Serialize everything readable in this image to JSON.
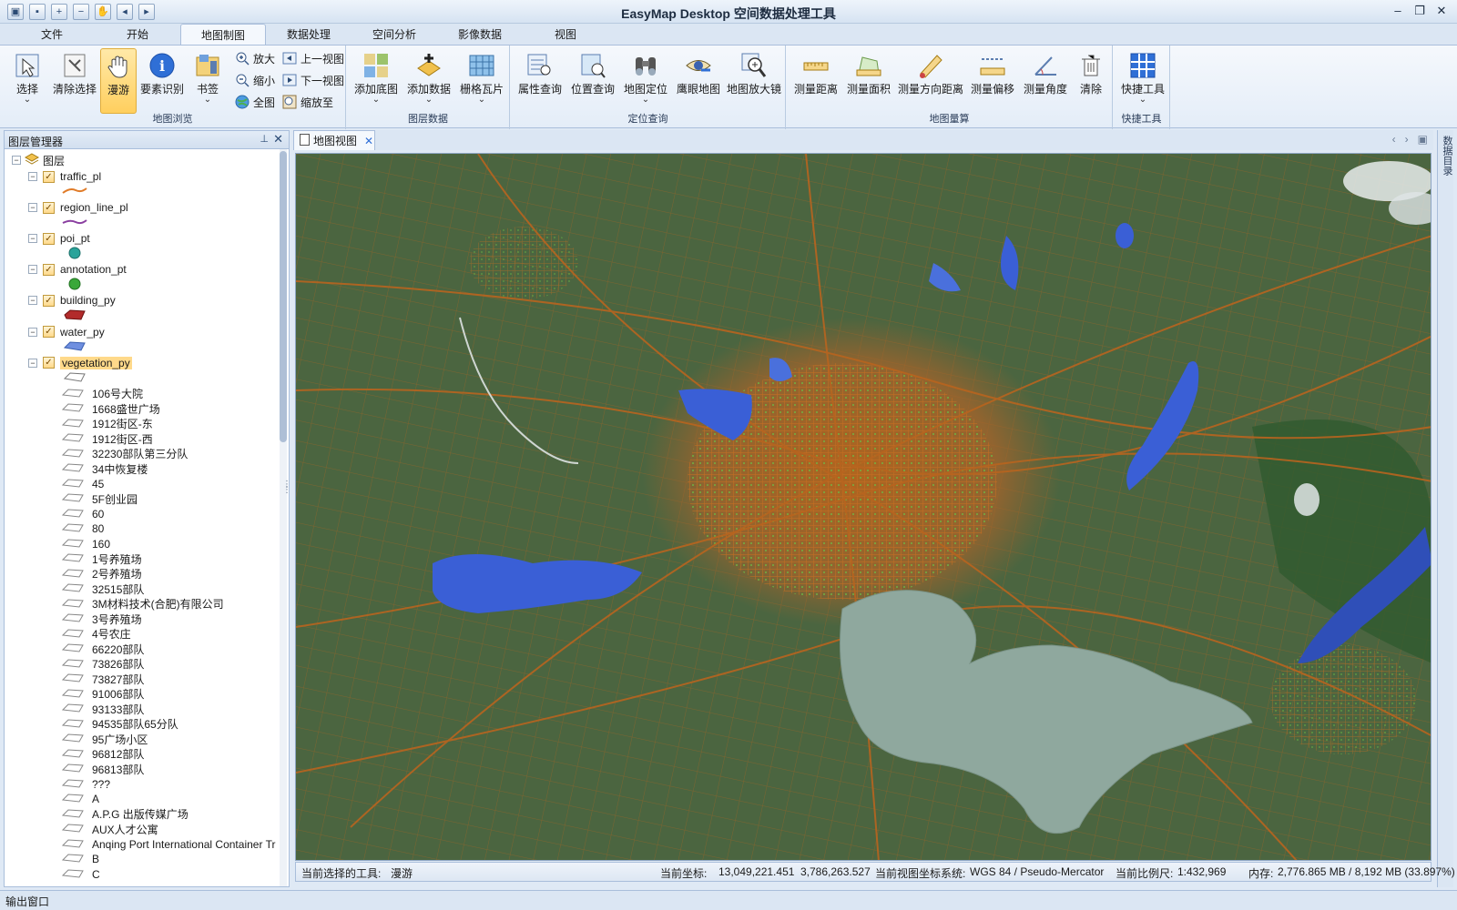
{
  "window": {
    "title": "EasyMap Desktop 空间数据处理工具",
    "quick_access": [
      "app-icon",
      "save-icon",
      "zoom-in-icon",
      "zoom-out-icon",
      "pan-icon",
      "prev-view-icon",
      "next-view-icon"
    ],
    "controls": [
      "minimize-icon",
      "restore-icon",
      "close-icon"
    ]
  },
  "ribbon_tabs": [
    "文件",
    "开始",
    "地图制图",
    "数据处理",
    "空间分析",
    "影像数据",
    "视图"
  ],
  "active_tab": "地图制图",
  "ribbon": {
    "browse": {
      "caption": "地图浏览",
      "select": "选择",
      "clear_select": "清除选择",
      "pan": "漫游",
      "identify": "要素识别",
      "bookmark": "书签",
      "zoom_in": "放大",
      "zoom_out": "缩小",
      "full_extent": "全图",
      "prev_view": "上一视图",
      "next_view": "下一视图",
      "zoom_to": "缩放至"
    },
    "layer_data": {
      "caption": "图层数据",
      "add_basemap": "添加底图",
      "add_data": "添加数据",
      "raster_tiles": "栅格瓦片"
    },
    "locate": {
      "caption": "定位查询",
      "attr_query": "属性查询",
      "loc_query": "位置查询",
      "map_locate": "地图定位",
      "eagle_eye": "鹰眼地图",
      "magnifier": "地图放大镜"
    },
    "measure": {
      "caption": "地图量算",
      "distance": "测量距离",
      "area": "测量面积",
      "bearing": "测量方向距离",
      "offset": "测量偏移",
      "angle": "测量角度",
      "clear": "清除"
    },
    "quick": {
      "caption": "快捷工具",
      "tools": "快捷工具"
    }
  },
  "layer_panel": {
    "title": "图层管理器",
    "root": "图层",
    "layers": [
      {
        "name": "traffic_pl",
        "symbol": "line-orange"
      },
      {
        "name": "region_line_pl",
        "symbol": "line-purple"
      },
      {
        "name": "poi_pt",
        "symbol": "point-teal"
      },
      {
        "name": "annotation_pt",
        "symbol": "point-green"
      },
      {
        "name": "building_py",
        "symbol": "polygon-red"
      },
      {
        "name": "water_py",
        "symbol": "polygon-blue"
      },
      {
        "name": "vegetation_py",
        "symbol": "polygon-empty",
        "selected": true
      }
    ],
    "vegetation_items": [
      "106号大院",
      "1668盛世广场",
      "1912街区-东",
      "1912街区-西",
      "32230部队第三分队",
      "34中恢复楼",
      "45",
      "5F创业园",
      "60",
      "80",
      "160",
      "1号养殖场",
      "2号养殖场",
      "32515部队",
      "3M材料技术(合肥)有限公司",
      "3号养殖场",
      "4号农庄",
      "66220部队",
      "73826部队",
      "73827部队",
      "91006部队",
      "93133部队",
      "94535部队65分队",
      "95广场小区",
      "96812部队",
      "96813部队",
      "???",
      "A",
      "A.P.G 出版传媒广场",
      "AUX人才公寓",
      "Anqing Port International Container Tr",
      "B",
      "C"
    ]
  },
  "map_tab": {
    "label": "地图视图"
  },
  "right_strip": {
    "label": "数据目录"
  },
  "status": {
    "tool_label": "当前选择的工具:",
    "tool_value": "漫游",
    "coord_label": "当前坐标:",
    "coord_x": "13,049,221.451",
    "coord_y": "3,786,263.527",
    "crs_label": "当前视图坐标系统:",
    "crs_value": "WGS 84 / Pseudo-Mercator",
    "scale_label": "当前比例尺:",
    "scale_value": "1:432,969",
    "mem_label": "内存:",
    "mem_value": "2,776.865 MB / 8,192 MB (33.897%)"
  },
  "output": {
    "label": "输出窗口"
  },
  "colors": {
    "ribbon_bg": "#e4edf8",
    "active_button": "#ffcf5e",
    "map_land": "#3f5e3a",
    "road": "#b5651d",
    "water": "#3a5fd6",
    "lake": "#8fa89e"
  }
}
